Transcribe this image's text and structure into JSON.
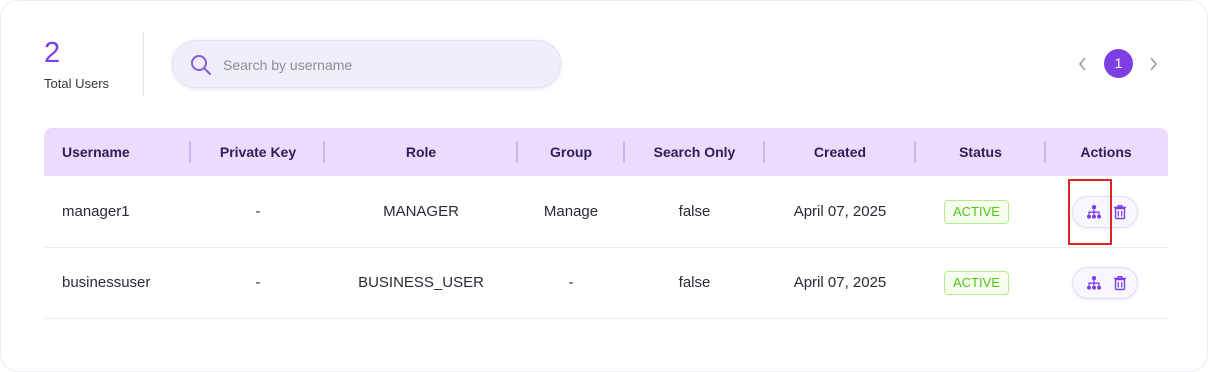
{
  "stats": {
    "count": "2",
    "label": "Total Users"
  },
  "search": {
    "placeholder": "Search by username",
    "value": ""
  },
  "pagination": {
    "prev": "‹",
    "current": "1",
    "next": "›"
  },
  "table": {
    "headers": [
      "Username",
      "Private Key",
      "Role",
      "Group",
      "Search Only",
      "Created",
      "Status",
      "Actions"
    ],
    "rows": [
      {
        "username": "manager1",
        "private_key": "-",
        "role": "MANAGER",
        "group": "Manage",
        "search_only": "false",
        "created": "April 07, 2025",
        "status": "ACTIVE"
      },
      {
        "username": "businessuser",
        "private_key": "-",
        "role": "BUSINESS_USER",
        "group": "-",
        "search_only": "false",
        "created": "April 07, 2025",
        "status": "ACTIVE"
      }
    ]
  },
  "colors": {
    "accent": "#7b3fe4",
    "header_bg": "#ebdbfd",
    "active_green": "#52c41a"
  },
  "icons": {
    "search": "search-icon",
    "assign": "hierarchy-icon",
    "delete": "trash-icon",
    "prev": "chevron-left-icon",
    "next": "chevron-right-icon"
  }
}
